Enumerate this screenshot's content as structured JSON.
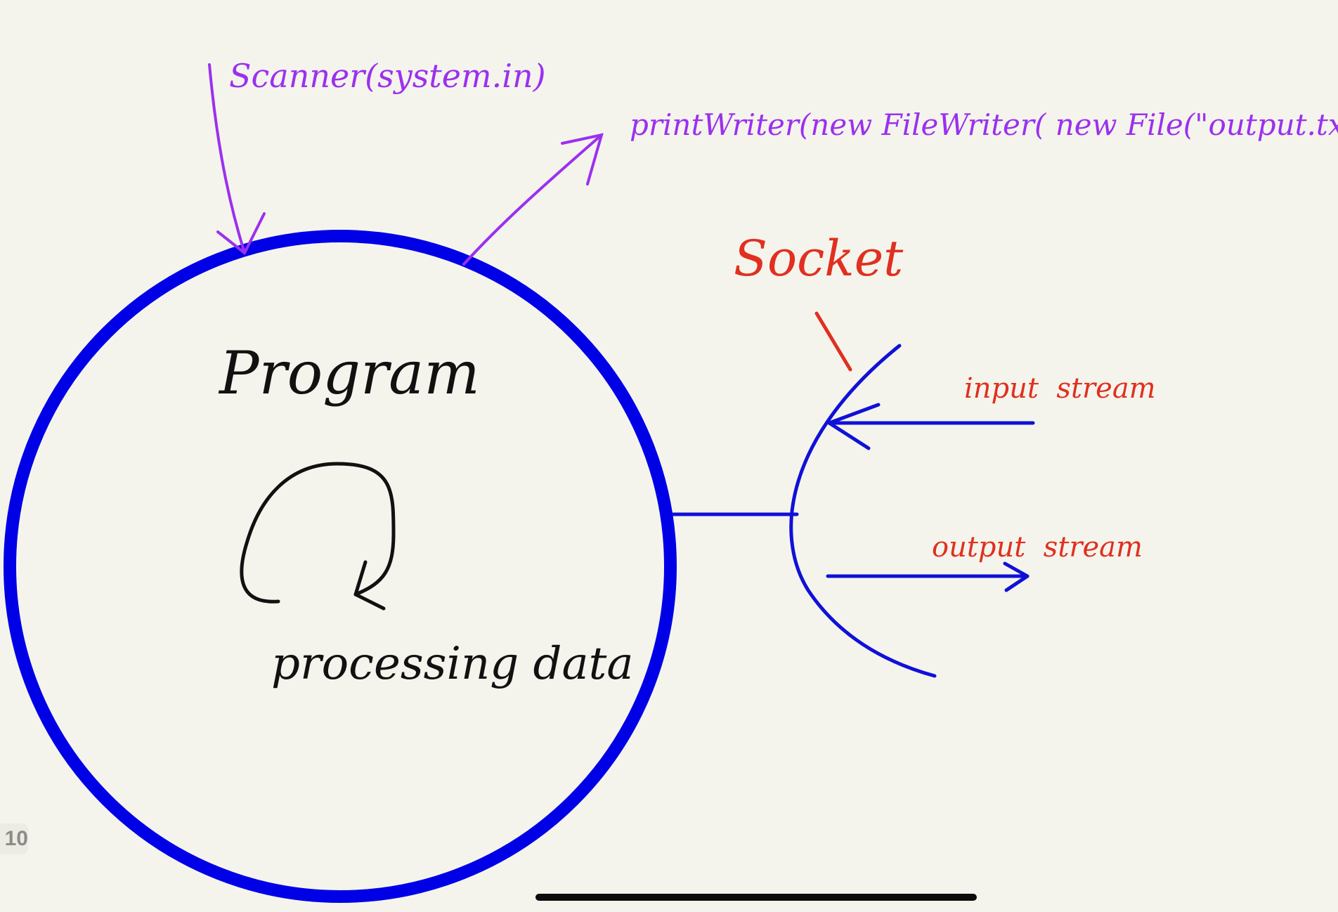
{
  "diagram": {
    "labels": {
      "scanner": "Scanner(system.in)",
      "printwriter": "printWriter(new FileWriter( new File(\"output.txt\")))",
      "socket": "Socket",
      "program": "Program",
      "processing": "processing data",
      "input_stream": "input  stream",
      "output_stream": "output  stream"
    },
    "colors": {
      "circle": "#0000e6",
      "purple": "#9b30ef",
      "red": "#e03020",
      "ink": "#111111",
      "socket_blue": "#1010d8",
      "background": "#f5f4ec"
    }
  },
  "ui": {
    "page_number": "10"
  }
}
